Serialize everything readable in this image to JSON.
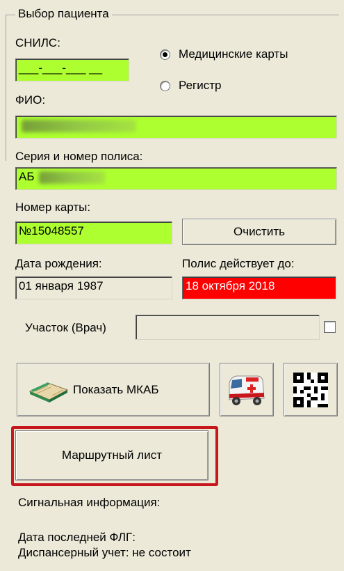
{
  "group_title": "Выбор пациента",
  "snils": {
    "label": "СНИЛС:",
    "value": "___-___-___ __"
  },
  "mode": {
    "options": [
      {
        "label": "Медицинские карты",
        "selected": true
      },
      {
        "label": "Регистр",
        "selected": false
      }
    ]
  },
  "fio": {
    "label": "ФИО:",
    "value": ""
  },
  "policy": {
    "label": "Серия и номер полиса:",
    "value": "АБ"
  },
  "card": {
    "label": "Номер карты:",
    "value": "№15048557"
  },
  "clear_button": "Очистить",
  "birth": {
    "label": "Дата рождения:",
    "value": "01 января 1987"
  },
  "policy_valid": {
    "label": "Полис действует до:",
    "value": "18 октября 2018"
  },
  "district": {
    "label": "Участок (Врач)",
    "value": ""
  },
  "show_mkab_button": "Показать МКАБ",
  "route_sheet_button": "Маршрутный лист",
  "signal_info": "Сигнальная  информация:",
  "last_flg": "Дата последней ФЛГ:",
  "dispensary": "Диспансерный учет: не состоит",
  "colors": {
    "ok_field": "#adff2f",
    "expired": "#ff0000",
    "highlight": "#c8161d"
  }
}
